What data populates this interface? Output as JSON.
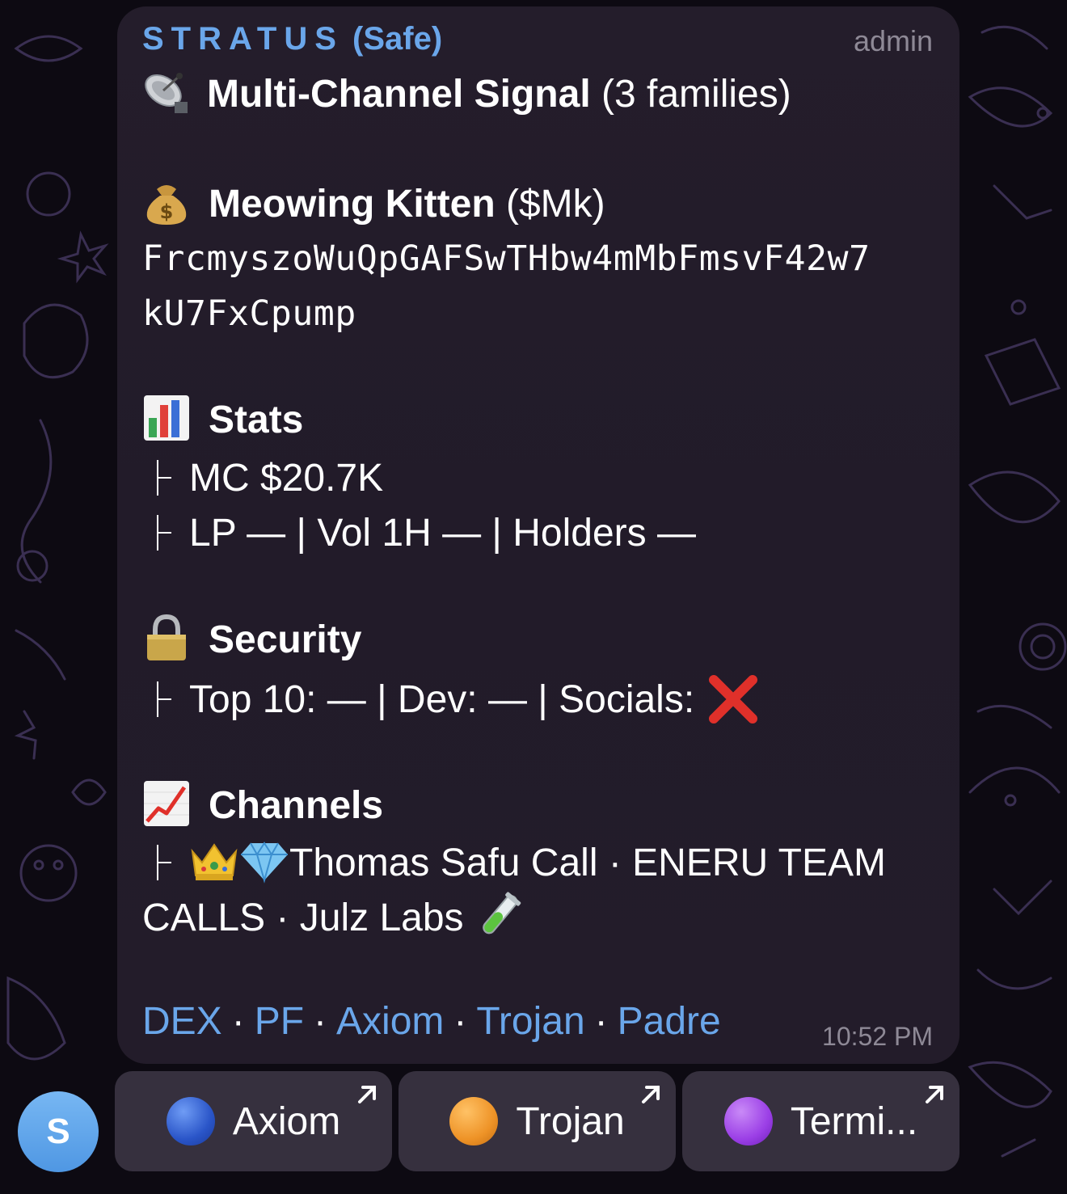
{
  "message": {
    "sender_spaced": "STRATUS",
    "sender_suffix": " (Safe)",
    "sender_badge": "admin",
    "header_icon": "satellite-antenna-icon",
    "header_title": "Multi-Channel Signal",
    "header_count": "(3 families)",
    "token": {
      "icon": "money-bag-icon",
      "name": "Meowing Kitten",
      "ticker": "($Mk)",
      "address_line1": "FrcmyszoWuQpGAFSwTHbw4mMbFmsvF42w7",
      "address_line2": "kU7FxCpump"
    },
    "stats": {
      "icon": "bar-chart-icon",
      "title": "Stats",
      "mc": "MC $20.7K",
      "liquidity": "LP — | Vol 1H — | Holders —"
    },
    "security": {
      "icon": "lock-icon",
      "title": "Security",
      "line": "Top 10: — | Dev: — | Socials:",
      "socials_status_icon": "cross-mark-icon"
    },
    "channels": {
      "icon": "chart-increasing-icon",
      "title": "Channels",
      "line1": "Thomas Safu Call · ENERU TEAM",
      "line2": "CALLS · Julz Labs",
      "prefix_icons": [
        "crown-icon",
        "gem-icon"
      ],
      "suffix_icon": "test-tube-icon"
    },
    "links": [
      "DEX",
      "PF",
      "Axiom",
      "Trojan",
      "Padre"
    ],
    "link_separator": "·",
    "time": "10:52 PM"
  },
  "inline_buttons": [
    {
      "label": "Axiom",
      "dot_color": "#2f5fd6",
      "icon": "blue-circle-icon"
    },
    {
      "label": "Trojan",
      "dot_color": "#f09a2a",
      "icon": "orange-circle-icon"
    },
    {
      "label": "Termi...",
      "dot_color": "#9b3fe6",
      "icon": "purple-circle-icon"
    }
  ],
  "avatar": {
    "initial": "S",
    "color": "#5fa5ea"
  },
  "colors": {
    "link": "#6aa6ea",
    "bubble": "#231c2a",
    "muted": "#8e8996"
  }
}
